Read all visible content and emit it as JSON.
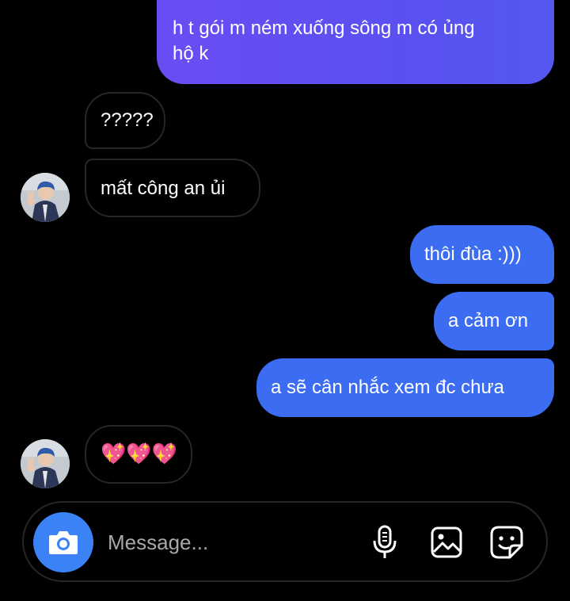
{
  "messages": [
    {
      "direction": "outgoing",
      "lines": [
        "h t gói m ném xuống sông m có ủng",
        "hộ k"
      ]
    },
    {
      "direction": "incoming",
      "text": "?????"
    },
    {
      "direction": "incoming",
      "text": "mất công an ủi"
    },
    {
      "direction": "outgoing",
      "text": "thôi đùa :)))"
    },
    {
      "direction": "outgoing",
      "text": "a cảm ơn"
    },
    {
      "direction": "outgoing",
      "text": "a sẽ cân nhắc xem đc chưa"
    },
    {
      "direction": "incoming",
      "text": "💖💖💖"
    }
  ],
  "composer": {
    "placeholder": "Message...",
    "icons": [
      "camera-icon",
      "microphone-icon",
      "image-icon",
      "sticker-icon"
    ]
  },
  "colors": {
    "background": "#000000",
    "outgoing_bubble": "#3b6cf2",
    "outgoing_bubble_gradient": "#6a4df2",
    "incoming_border": "#262626",
    "camera_button": "#3b82f6",
    "placeholder": "#a8a8a8"
  }
}
